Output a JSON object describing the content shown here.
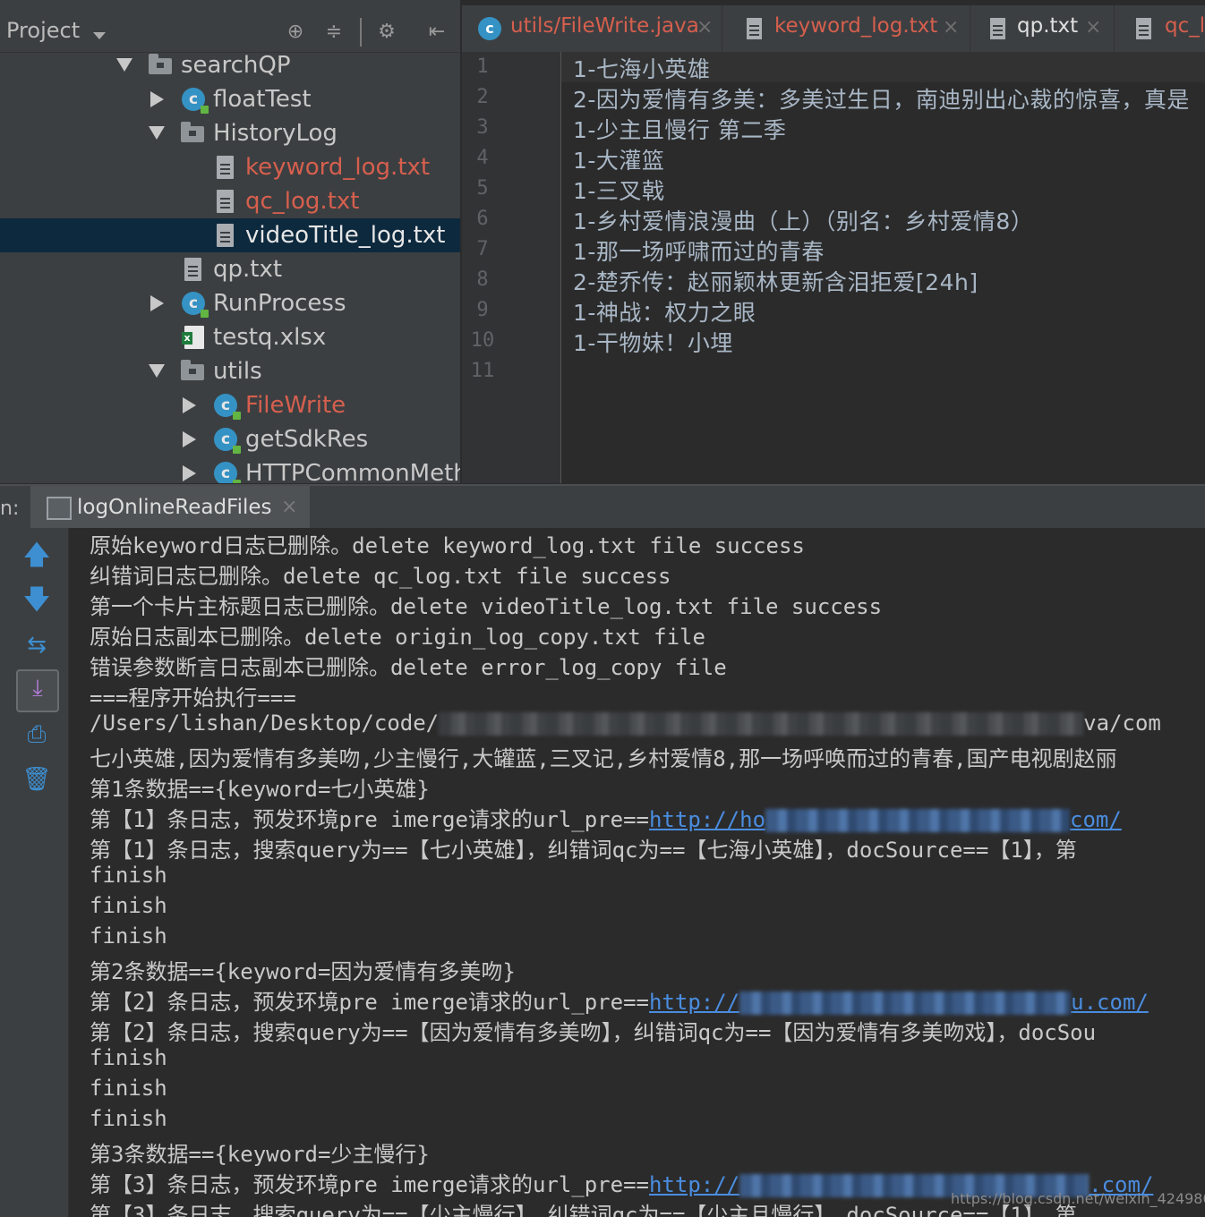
{
  "project": {
    "title": "Project",
    "icons": [
      "crosshair-icon",
      "collapse-all-icon",
      "gear-icon",
      "hide-panel-icon"
    ],
    "tree": [
      {
        "label": "searchQP",
        "icon": "folder-icon",
        "expanded": true
      },
      {
        "label": "floatTest",
        "icon": "class-icon",
        "expanded": false
      },
      {
        "label": "HistoryLog",
        "icon": "folder-icon",
        "expanded": true
      },
      {
        "label": "keyword_log.txt",
        "icon": "text-file-icon",
        "color": "#d65f4e"
      },
      {
        "label": "qc_log.txt",
        "icon": "text-file-icon",
        "color": "#d65f4e"
      },
      {
        "label": "videoTitle_log.txt",
        "icon": "text-file-icon",
        "selected": true
      },
      {
        "label": "qp.txt",
        "icon": "text-file-icon"
      },
      {
        "label": "RunProcess",
        "icon": "class-icon",
        "expanded": false
      },
      {
        "label": "testq.xlsx",
        "icon": "excel-file-icon"
      },
      {
        "label": "utils",
        "icon": "folder-icon",
        "expanded": true
      },
      {
        "label": "FileWrite",
        "icon": "class-icon",
        "expanded": false,
        "color": "#d65f4e"
      },
      {
        "label": "getSdkRes",
        "icon": "class-icon",
        "expanded": false
      },
      {
        "label": "HTTPCommonMeth",
        "icon": "class-icon",
        "expanded": false
      }
    ]
  },
  "editor": {
    "tabs": [
      {
        "label": "utils/FileWrite.java",
        "icon": "class-icon",
        "color": "#d65f4e"
      },
      {
        "label": "keyword_log.txt",
        "icon": "text-file-icon",
        "color": "#d65f4e"
      },
      {
        "label": "qp.txt",
        "icon": "text-file-icon",
        "color": "#e0e0e0"
      },
      {
        "label": "qc_l",
        "icon": "text-file-icon",
        "color": "#d65f4e"
      }
    ],
    "line_numbers": [
      "1",
      "2",
      "3",
      "4",
      "5",
      "6",
      "7",
      "8",
      "9",
      "10",
      "11"
    ],
    "lines": [
      "1-七海小英雄",
      "2-因为爱情有多美：多美过生日，南迪别出心裁的惊喜，真是",
      "1-少主且慢行 第二季",
      "1-大灌篮",
      "1-三叉戟",
      "1-乡村爱情浪漫曲（上）（别名：乡村爱情8）",
      "1-那一场呼啸而过的青春",
      "2-楚乔传：赵丽颖林更新含泪拒爱[24h]",
      "1-神战：权力之眼",
      "1-干物妹！小埋",
      ""
    ]
  },
  "run": {
    "prefix": "n:",
    "tab_label": "logOnlineReadFiles",
    "toolbar": [
      "up-arrow-icon",
      "down-arrow-icon",
      "rerun-toggle-icon",
      "soft-wrap-icon",
      "print-icon",
      "trash-icon"
    ],
    "console": {
      "l1": "原始keyword日志已删除。delete keyword_log.txt file success",
      "l2": "纠错词日志已删除。delete qc_log.txt file success",
      "l3": "第一个卡片主标题日志已删除。delete videoTitle_log.txt file success",
      "l4": "原始日志副本已删除。delete origin_log_copy.txt file",
      "l5": "错误参数断言日志副本已删除。delete error_log_copy file",
      "l6": "===程序开始执行===",
      "l7a": "/Users/lishan/Desktop/code/",
      "l7b": "va/com",
      "l8": "七小英雄,因为爱情有多美吻,少主慢行,大罐蓝,三叉记,乡村爱情8,那一场呼唤而过的青春,国产电视剧赵丽",
      "l9": "第1条数据=={keyword=七小英雄}",
      "l10a": "第【1】条日志，预发环境pre imerge请求的url_pre==",
      "l10b": "http://ho",
      "l10c": "com/",
      "l11": "第【1】条日志，搜索query为==【七小英雄】，纠错词qc为==【七海小英雄】，docSource==【1】，第",
      "l12": "finish",
      "l13": "finish",
      "l14": "finish",
      "l15": "第2条数据=={keyword=因为爱情有多美吻}",
      "l16a": "第【2】条日志，预发环境pre imerge请求的url_pre==",
      "l16b": "http://",
      "l16c": "u.com/",
      "l17": "第【2】条日志，搜索query为==【因为爱情有多美吻】，纠错词qc为==【因为爱情有多美吻戏】，docSou",
      "l18": "finish",
      "l19": "finish",
      "l20": "finish",
      "l21": "第3条数据=={keyword=少主慢行}",
      "l22a": "第【3】条日志，预发环境pre imerge请求的url_pre==",
      "l22b": "http://",
      "l22c": ".com/",
      "l23": "第【3】条日志，搜索query为==【少主慢行】，纠错词qc为==【少主且慢行】，docSource==【1】，第"
    }
  },
  "watermark": "https://blog.csdn.net/weixin_42498050"
}
